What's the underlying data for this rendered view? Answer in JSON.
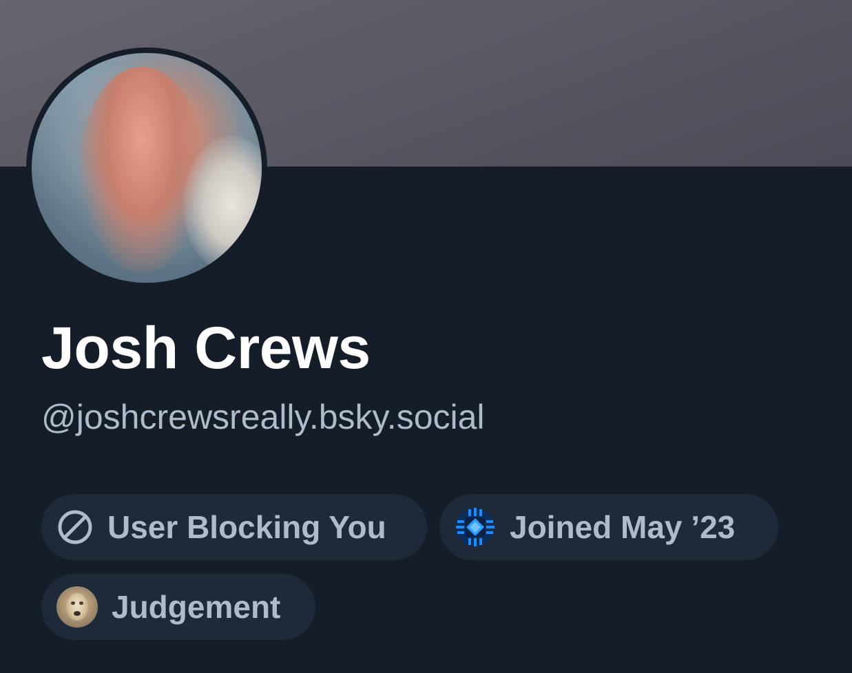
{
  "profile": {
    "display_name": "Josh Crews",
    "handle": "@joshcrewsreally.bsky.social",
    "avatar_icon": "avatar-photo-blurred"
  },
  "badges": [
    {
      "label": "User Blocking You",
      "icon": "block-icon"
    },
    {
      "label": "Joined May ’23",
      "icon": "bluesky-pixel-icon"
    },
    {
      "label": "Judgement",
      "icon": "judgement-face-icon"
    }
  ],
  "colors": {
    "background": "#151d29",
    "banner": "#5a5964",
    "pill_bg": "#1e2a3a",
    "muted_text": "#aebbcb",
    "name_text": "#ffffff",
    "accent_blue": "#1f8bff"
  }
}
